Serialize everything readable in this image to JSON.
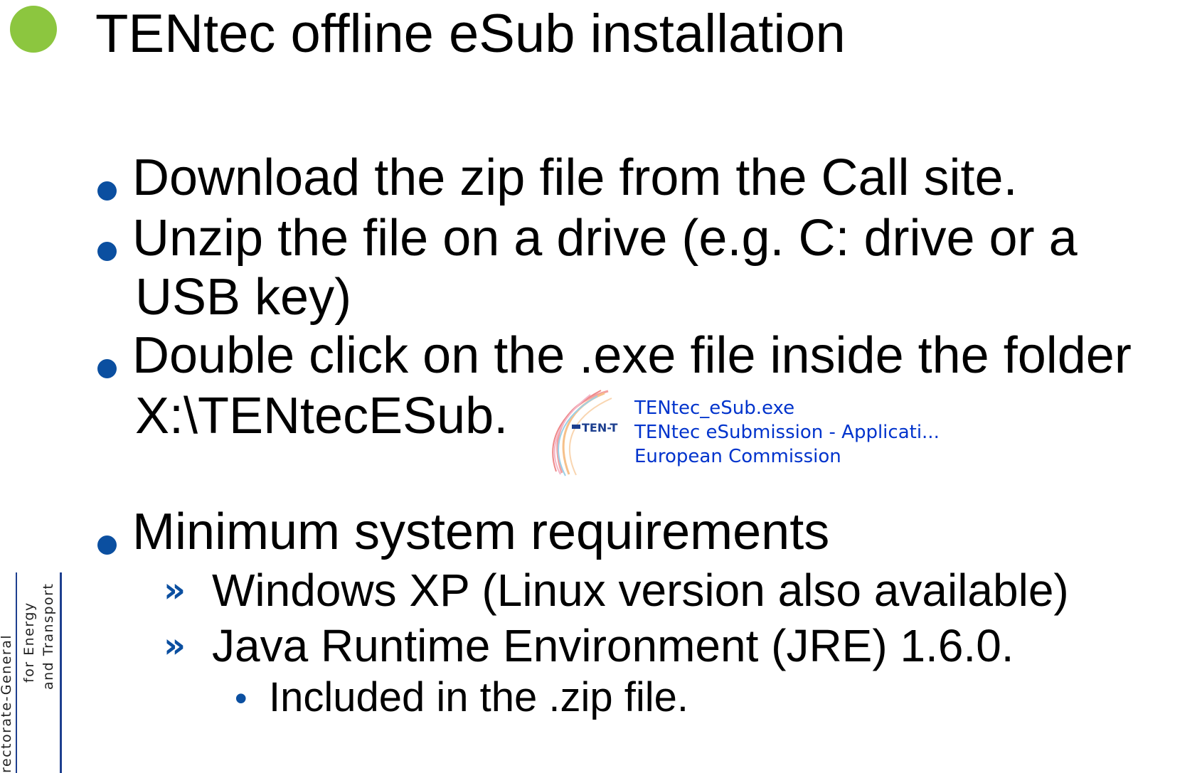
{
  "slide": {
    "title": "TENtec offline eSub installation",
    "bullets": [
      {
        "line1": " Download the zip file from the Call site."
      },
      {
        "line1": " Unzip the file on a drive (e.g. C: drive or a",
        "line2": "USB key)"
      },
      {
        "line1": " Double click on the .exe file inside the folder",
        "line2": "X:\\TENtecESub."
      },
      {
        "line1": " Minimum system requirements"
      }
    ],
    "requirements": [
      {
        "marker": "»",
        "text": "Windows XP (Linux version also available)"
      },
      {
        "marker": "»",
        "text": "Java Runtime Environment (JRE) 1.6.0."
      }
    ],
    "requirement_note": {
      "marker": "•",
      "text": "Included in the .zip file."
    }
  },
  "file_entry": {
    "icon_label": "TEN-T",
    "filename": "TENtec_eSub.exe",
    "description": "TENtec eSubmission - Applicati...",
    "publisher": "European Commission"
  },
  "footer_logo": {
    "line1": "rectorate-General",
    "line2": "for Energy",
    "line3": "and Transport"
  },
  "colors": {
    "title_dot": "#8cc63f",
    "bullet": "#0b4fa0",
    "file_text": "#0033cc"
  }
}
